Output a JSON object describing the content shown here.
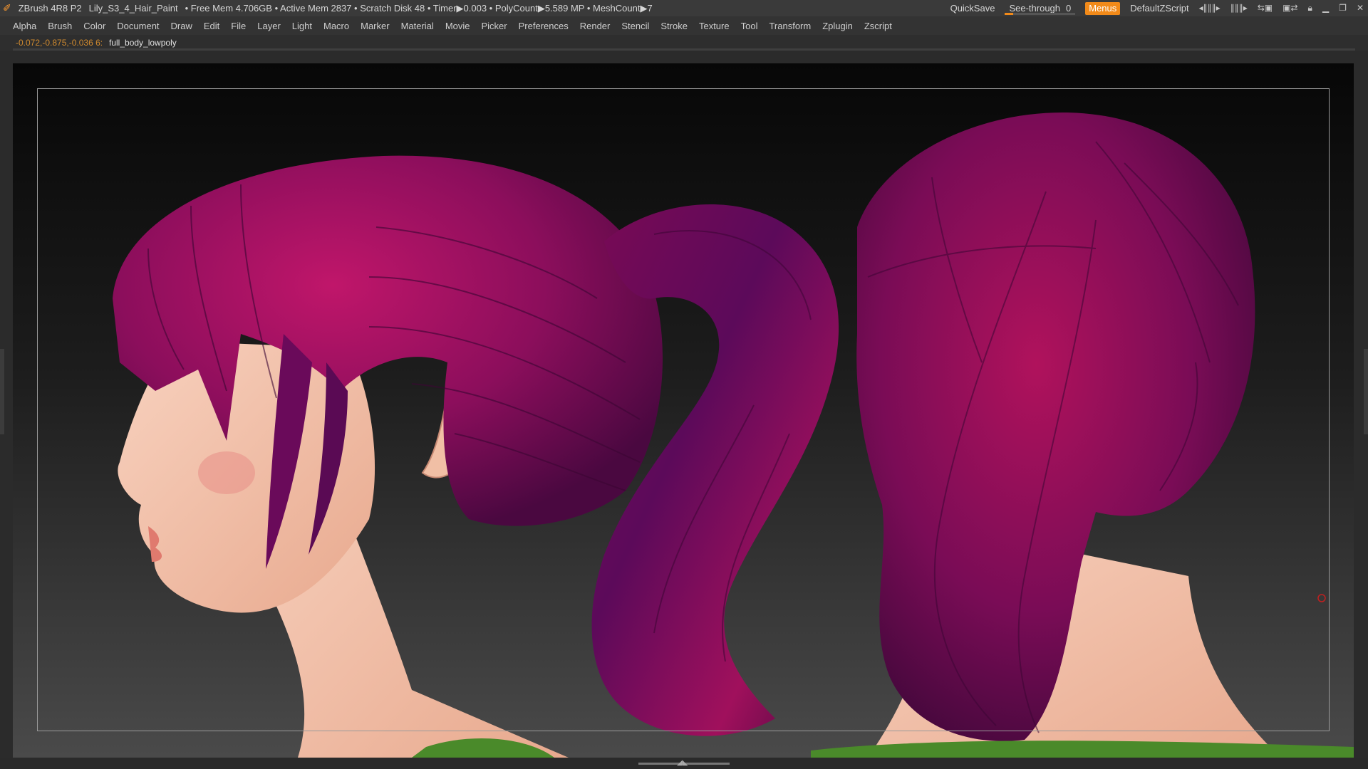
{
  "app": {
    "logo_icon": "zbrush-logo-icon",
    "name": "ZBrush 4R8 P2",
    "file": "Lily_S3_4_Hair_Paint",
    "stats": "• Free Mem 4.706GB • Active Mem 2837 • Scratch Disk 48 • Timer▶0.003 • PolyCount▶5.589 MP • MeshCount▶7"
  },
  "titlebar": {
    "quicksave": "QuickSave",
    "see_through_label": "See-through",
    "see_through_value": "0",
    "menus": "Menus",
    "script": "DefaultZScript",
    "accent": "#f28a19"
  },
  "menu": [
    "Alpha",
    "Brush",
    "Color",
    "Document",
    "Draw",
    "Edit",
    "File",
    "Layer",
    "Light",
    "Macro",
    "Marker",
    "Material",
    "Movie",
    "Picker",
    "Preferences",
    "Render",
    "Stencil",
    "Stroke",
    "Texture",
    "Tool",
    "Transform",
    "Zplugin",
    "Zscript"
  ],
  "info": {
    "coords": "-0.072,-0.875,-0.036 6:",
    "tool": "full_body_lowpoly"
  },
  "colors": {
    "hair_dark": "#5a0a4a",
    "hair_mid": "#8c0e5c",
    "hair_light": "#b4145e",
    "skin": "#f3c4ad",
    "shirt": "#4a8a2a"
  }
}
